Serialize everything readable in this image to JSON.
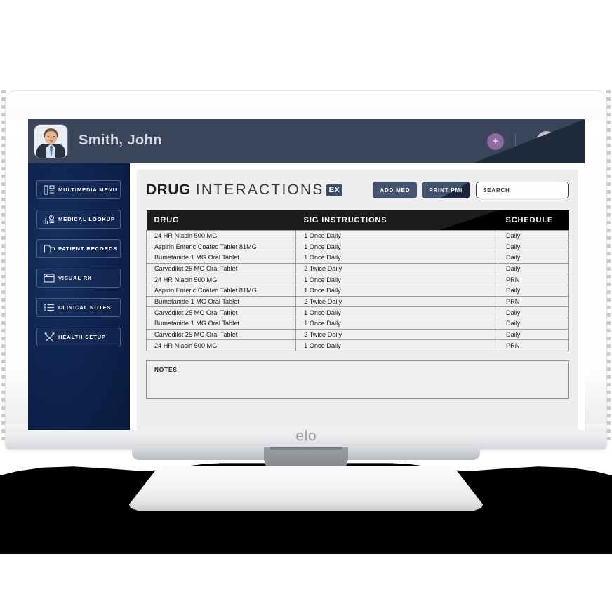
{
  "device": {
    "brand_logo": "elo"
  },
  "appbar": {
    "patient_name": "Smith, John",
    "add_button_label": "+",
    "icons": {
      "add": "plus-icon",
      "avatar": "user-avatar",
      "caret": "chevron-down-icon"
    }
  },
  "sidebar": {
    "items": [
      {
        "label": "MULTIMEDIA MENU",
        "icon": "layout-panel-icon"
      },
      {
        "label": "MEDICAL LOOKUP",
        "icon": "chart-clock-icon"
      },
      {
        "label": "PATIENT RECORDS",
        "icon": "folder-tag-icon"
      },
      {
        "label": "VISUAL RX",
        "icon": "window-icon"
      },
      {
        "label": "CLINICAL NOTES",
        "icon": "list-icon"
      },
      {
        "label": "HEALTH SETUP",
        "icon": "tools-icon"
      }
    ]
  },
  "main": {
    "title_bold": "DRUG",
    "title_light": "INTERACTIONS",
    "title_badge": "EX",
    "buttons": {
      "add_med": "ADD MED",
      "print_pmi": "PRINT PMI"
    },
    "search": {
      "value": "",
      "placeholder": "SEARCH"
    },
    "table": {
      "columns": [
        "DRUG",
        "SIG INSTRUCTIONS",
        "SCHEDULE"
      ],
      "rows": [
        [
          "24 HR Niacin 500 MG",
          "1 Once Daily",
          "Daily"
        ],
        [
          "Aspirin Enteric Coated Tablet 81MG",
          "1 Once Daily",
          "Daily"
        ],
        [
          "Bumetanide 1 MG Oral Tablet",
          "1 Once Daily",
          "Daily"
        ],
        [
          "Carvedilot 25 MG Oral Tablet",
          "2 Twice Daily",
          "Daily"
        ],
        [
          "24 HR Niacin 500 MG",
          "1 Once Daily",
          "PRN"
        ],
        [
          "Aspirin Enteric Coated Tablet 81MG",
          "1 Once Daily",
          "Daily"
        ],
        [
          "Bumetanide 1 MG Oral Tablet",
          "2 Twice Daily",
          "PRN"
        ],
        [
          "Carvedilot 25 MG Oral Tablet",
          "1 Once Daily",
          "Daily"
        ],
        [
          "Bumetanide 1 MG Oral Tablet",
          "1 Once Daily",
          "Daily"
        ],
        [
          "Carvedilot 25 MG Oral Tablet",
          "2 Twice Daily",
          "Daily"
        ],
        [
          "24 HR Niacin 500 MG",
          "1 Once Daily",
          "PRN"
        ]
      ]
    },
    "notes": {
      "label": "NOTES",
      "value": ""
    }
  },
  "colors": {
    "appbar": "#3a4559",
    "appbar_dark": "#1f2a3d",
    "sidebar": "#0f2450",
    "accent_purple": "#8f6aa3",
    "button_blue": "#44546e",
    "badge_blue": "#3d4e6b",
    "table_header": "#1c1c1c",
    "panel_bg": "#eeeeee"
  }
}
